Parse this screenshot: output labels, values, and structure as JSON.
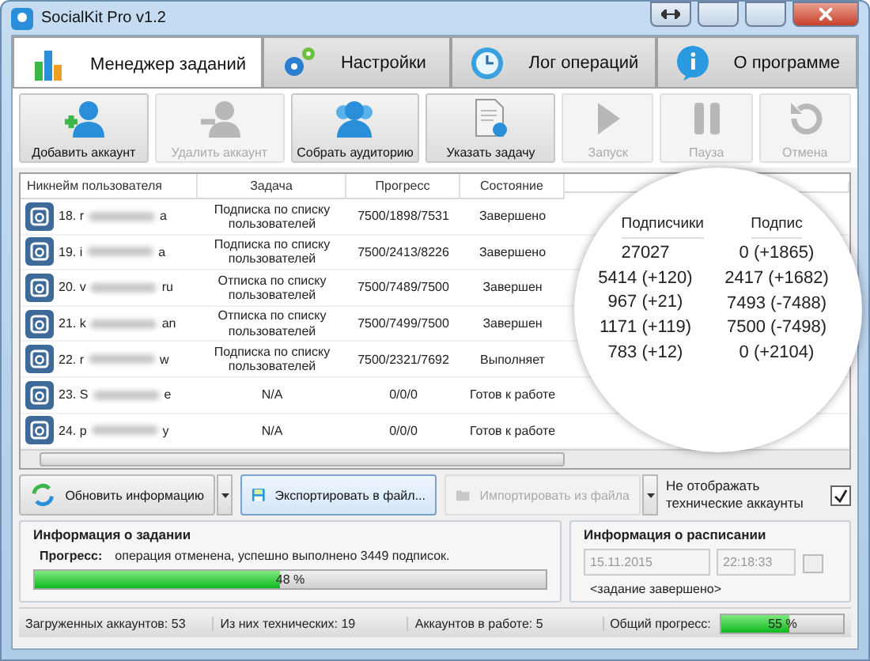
{
  "window": {
    "title": "SocialKit Pro v1.2"
  },
  "tabs": [
    {
      "label": "Менеджер заданий",
      "selected": true
    },
    {
      "label": "Настройки",
      "selected": false
    },
    {
      "label": "Лог операций",
      "selected": false
    },
    {
      "label": "О программе",
      "selected": false
    }
  ],
  "toolbar": [
    {
      "label": "Добавить аккаунт",
      "disabled": false
    },
    {
      "label": "Удалить аккаунт",
      "disabled": true
    },
    {
      "label": "Собрать аудиторию",
      "disabled": false
    },
    {
      "label": "Указать задачу",
      "disabled": false
    },
    {
      "label": "Запуск",
      "disabled": true
    },
    {
      "label": "Пауза",
      "disabled": true
    },
    {
      "label": "Отмена",
      "disabled": true
    }
  ],
  "table": {
    "columns": [
      "Никнейм пользователя",
      "Задача",
      "Прогресс",
      "Состояние"
    ],
    "rows": [
      {
        "name_start": "18. r",
        "name_end": "a",
        "task": "Подписка по списку пользователей",
        "progress": "7500/1898/7531",
        "state": "Завершено"
      },
      {
        "name_start": "19. i",
        "name_end": "a",
        "task": "Подписка по списку пользователей",
        "progress": "7500/2413/8226",
        "state": "Завершено"
      },
      {
        "name_start": "20. v",
        "name_end": "ru",
        "task": "Отписка по списку пользователей",
        "progress": "7500/7489/7500",
        "state": "Завершен"
      },
      {
        "name_start": "21. k",
        "name_end": "an",
        "task": "Отписка по списку пользователей",
        "progress": "7500/7499/7500",
        "state": "Завершен"
      },
      {
        "name_start": "22. r",
        "name_end": "w",
        "task": "Подписка по списку пользователей",
        "progress": "7500/2321/7692",
        "state": "Выполняет"
      },
      {
        "name_start": "23. S",
        "name_end": "e",
        "task": "N/A",
        "progress": "0/0/0",
        "state": "Готов к работе"
      },
      {
        "name_start": "24. p",
        "name_end": "y",
        "task": "N/A",
        "progress": "0/0/0",
        "state": "Готов к работе"
      }
    ]
  },
  "magnifier": {
    "columns": [
      "Подписчики",
      "Подпис"
    ],
    "rows": [
      {
        "subscribers": "27027",
        "subscriptions": "0 (+1865)"
      },
      {
        "subscribers": "5414 (+120)",
        "subscriptions": "2417 (+1682)"
      },
      {
        "subscribers": "967 (+21)",
        "subscriptions": "7493 (-7488)"
      },
      {
        "subscribers": "1171 (+119)",
        "subscriptions": "7500 (-7498)"
      },
      {
        "subscribers": "783 (+12)",
        "subscriptions": "0 (+2104)"
      }
    ]
  },
  "actions": [
    {
      "label": "Обновить информацию",
      "disabled": false,
      "selected": false,
      "dropdown": true
    },
    {
      "label": "Экспортировать в файл...",
      "disabled": false,
      "selected": true,
      "dropdown": false
    },
    {
      "label": "Импортировать из файла",
      "disabled": true,
      "selected": false,
      "dropdown": true
    }
  ],
  "hide_technical": {
    "label": "Не отображать технические аккаунты",
    "checked": true
  },
  "task_info": {
    "title": "Информация о задании",
    "progress_label": "Прогресс:",
    "progress_text": "операция отменена, успешно выполнено 3449 подписок.",
    "level": 0.48,
    "percent": "48 %"
  },
  "schedule": {
    "title": "Информация о расписании",
    "date": "15.11.2015",
    "time": "22:18:33",
    "status": "<задание завершено>"
  },
  "status_bar": [
    "Загруженных аккаунтов: 53",
    "Из них технических: 19",
    "Аккаунтов в работе: 5"
  ],
  "overall": {
    "label": "Общий прогресс:",
    "level": 0.55,
    "percent": "55 %"
  }
}
